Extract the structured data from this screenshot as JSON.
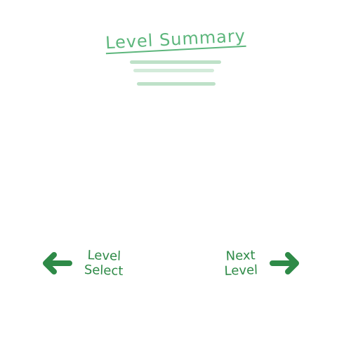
{
  "summary": {
    "title": "Level Summary"
  },
  "nav": {
    "level_select": {
      "label": "Level Select",
      "icon": "arrow-left-icon"
    },
    "next_level": {
      "label": "Next Level",
      "icon": "arrow-right-icon"
    }
  },
  "colors": {
    "title": "#4caf6e",
    "button": "#2e8a47",
    "scribble": "#a8d7b6"
  }
}
